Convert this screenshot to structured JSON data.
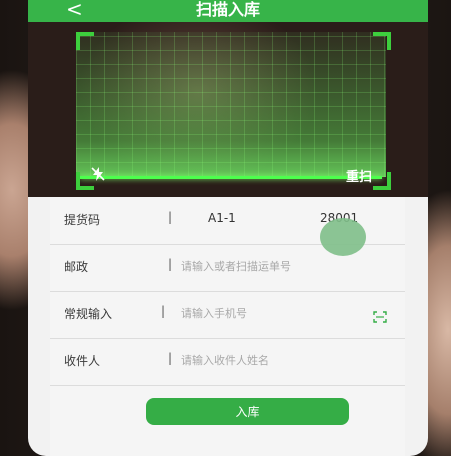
{
  "header": {
    "back_icon": "chevron-left-icon",
    "title": "扫描入库"
  },
  "scanner": {
    "flash_icon": "flash-off-icon",
    "rescan_label": "重扫"
  },
  "form": {
    "rows": [
      {
        "label": "提货码",
        "value1": "A1-1",
        "value2": "28001"
      },
      {
        "label": "邮政",
        "placeholder": "请输入或者扫描运单号"
      },
      {
        "label": "常规输入",
        "placeholder": "请输入手机号",
        "icon": "scan-icon"
      },
      {
        "label": "收件人",
        "placeholder": "请输入收件人姓名"
      }
    ],
    "separator": "|",
    "submit_label": "入库"
  },
  "colors": {
    "accent": "#37b449",
    "scan_line": "#4dff4d"
  }
}
